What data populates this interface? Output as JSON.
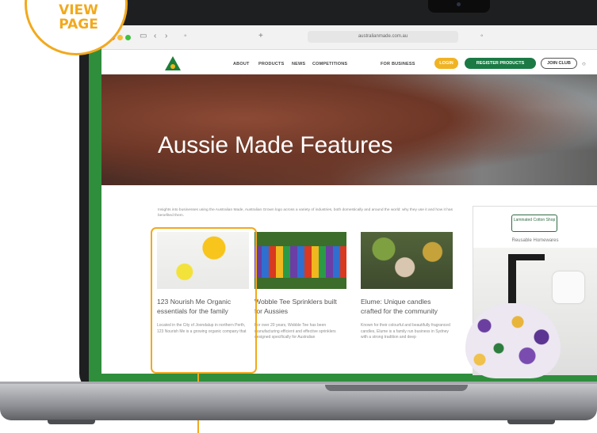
{
  "badge": {
    "line1": "VIEW",
    "line2": "PAGE"
  },
  "browser": {
    "url": "australianmade.com.au"
  },
  "nav": {
    "items": [
      "ABOUT",
      "PRODUCTS",
      "NEWS",
      "COMPETITIONS",
      "FOR BUSINESS"
    ],
    "login": "LOGIN",
    "register": "REGISTER PRODUCTS",
    "join": "JOIN CLUB"
  },
  "hero": {
    "title": "Aussie Made Features"
  },
  "intro": "Insights into businesses using the Australian Made, Australian Grown logo across a variety of industries, both domestically and around the world: why they use it and how it has benefited them.",
  "cards": [
    {
      "title": "123 Nourish Me Organic essentials for the family",
      "desc": "Located in the City of Joondalup in northern Perth, 123 Nourish Me is a growing organic company that"
    },
    {
      "title": "Wobble Tee Sprinklers built for Aussies",
      "desc": "For over 20 years, Wobble Tee has been manufacturing efficient and effective sprinklers designed specifically for Australian"
    },
    {
      "title": "Elume: Unique candles crafted for the community",
      "desc": "Known for their colourful and beautifully fragranced candles, Elume is a family run business in Sydney with a strong tradition and deep"
    }
  ],
  "ad": {
    "brand": "Laminated Cotton Shop",
    "tagline": "Reusable Homewares"
  },
  "colors": {
    "accent": "#f2a91d",
    "brand_green": "#2f8e3c"
  }
}
